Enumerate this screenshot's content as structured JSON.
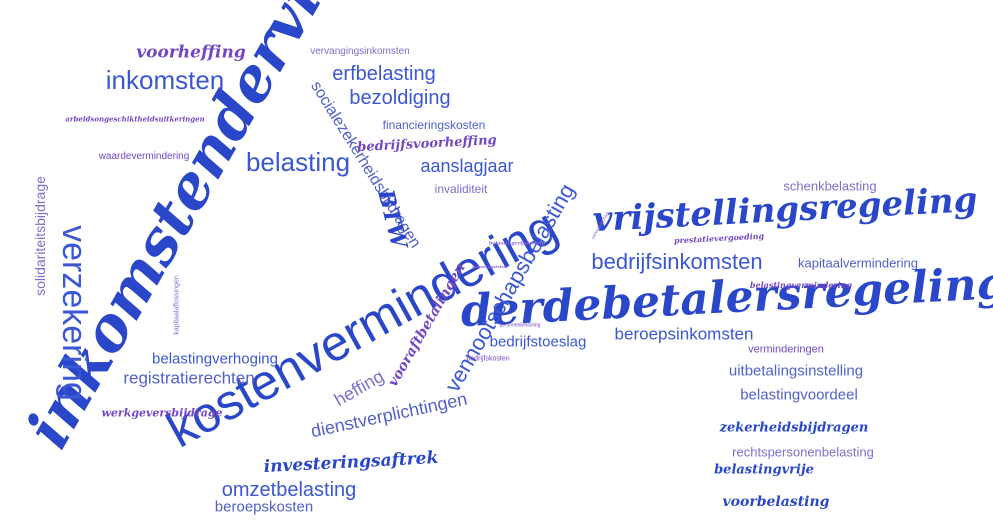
{
  "words": {
    "inkomstendervinq": "inkomstendervinq",
    "kostenvermindering": "kostenvermindering",
    "derdebetalersregeling": "derdebetalersregeling",
    "vrijstellingsregeling": "vrijstellingsregeling",
    "verzekering": "verzekering",
    "vennootschapsbelasting": "vennootschapsbelasting",
    "inkomsten": "inkomsten",
    "belasting": "belasting",
    "bedrijfsinkomsten": "bedrijfsinkomsten",
    "erfbelasting": "erfbelasting",
    "bezoldiging": "bezoldiging",
    "socialezekerheidsbijdragen": "socialezekerheidsbijdragen",
    "voorheffing": "voorheffing",
    "vervangingsinkomsten": "vervangingsinkomsten",
    "financieringskosten": "financieringskosten",
    "bedrijfsvoorheffing": "bedrijfsvoorheffing",
    "aanslagjaar": "aanslagjaar",
    "invaliditeit": "invaliditeit",
    "arbeidsongeschiktheidsuitkeringen": "arbeidsongeschiktheidsuitkeringen",
    "waardevermindering": "waardevermindering",
    "solidariteitsbijdrage": "solidariteitsbijdrage",
    "kapitaalaflossingen": "kapitaalaflossingen",
    "btw": "BTW",
    "schenkbelasting": "schenkbelasting",
    "prestatievergoeding": "prestatievergoeding",
    "kapitaalvermindering": "kapitaalvermindering",
    "belastingvermindering": "belastingvermindering",
    "beroepsinkomsten": "beroepsinkomsten",
    "verminderingen": "verminderingen",
    "uitbetalingsinstelling": "uitbetalingsinstelling",
    "belastingvoordeel": "belastingvoordeel",
    "zekerheidsbijdragen": "zekerheidsbijdragen",
    "rechtspersonenbelasting": "rechtspersonenbelasting",
    "belastingvrije": "belastingvrije",
    "voorbelasting": "voorbelasting",
    "bedrijfstoeslag": "bedrijfstoeslag",
    "vooraftbetalingen": "vooraftbetalingen",
    "heffing": "heffing",
    "dienstverplichtingen": "dienstverplichtingen",
    "belastingverhoging": "belastingverhoging",
    "registratierechten": "registratierechten",
    "werkgeversbijdrage": "werkgeversbijdrage",
    "investeringsaftrek": "investeringsaftrek",
    "omzetbelasting": "omzetbelasting",
    "beroepskosten": "beroepskosten",
    "personenbelasting": "personenbelasting",
    "bedrijfskosten": "bedrijfskosten",
    "belastingvrijstelling": "belastingvrijstelling",
    "belastingstelsel": "belastingstelsel",
    "vennootschap": "vennootschap"
  },
  "colors": {
    "dark": "#2a46c9",
    "blue": "#3b57d4",
    "purple": "#7347c4",
    "light_purple": "#8d68d2",
    "background": "#ffffff"
  }
}
